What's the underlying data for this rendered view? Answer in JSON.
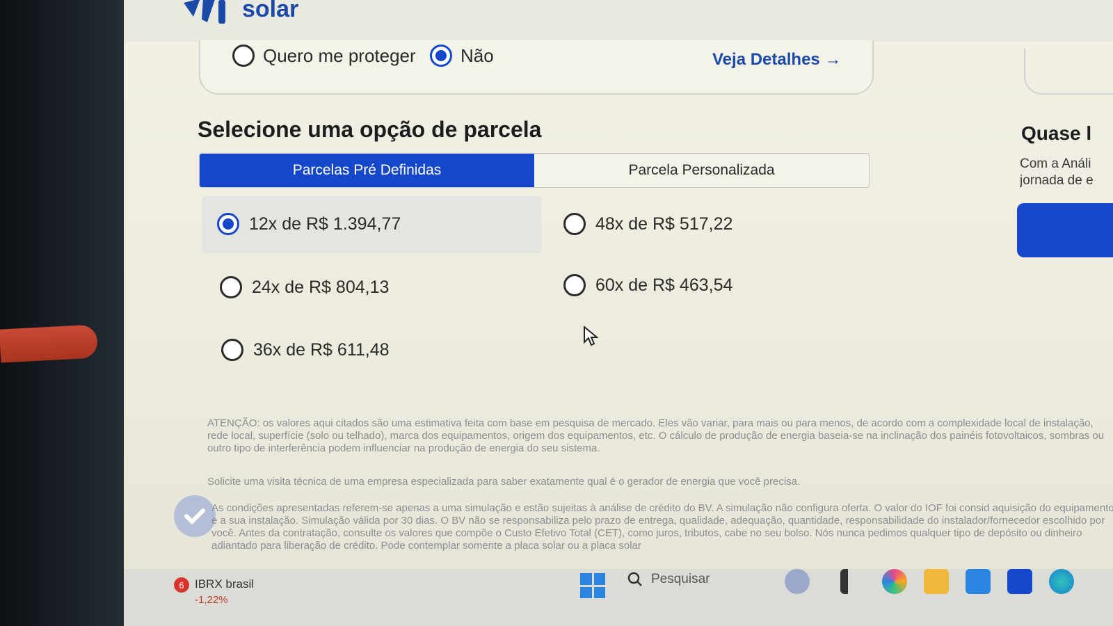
{
  "app": {
    "logo_text": "solar",
    "brand_color": "#1447c9"
  },
  "insurance": {
    "options": [
      {
        "label": "Quero me proteger",
        "selected": false
      },
      {
        "label": "Não",
        "selected": true
      }
    ],
    "details_link": "Veja Detalhes →"
  },
  "installments": {
    "title": "Selecione uma opção de parcela",
    "tabs": [
      {
        "label": "Parcelas Pré Definidas",
        "active": true
      },
      {
        "label": "Parcela Personalizada",
        "active": false
      }
    ],
    "options": [
      {
        "label": "12x de R$ 1.394,77",
        "selected": true
      },
      {
        "label": "24x de R$ 804,13",
        "selected": false
      },
      {
        "label": "36x de R$ 611,48",
        "selected": false
      },
      {
        "label": "48x de R$ 517,22",
        "selected": false
      },
      {
        "label": "60x de R$ 463,54",
        "selected": false
      }
    ]
  },
  "side_panel": {
    "title": "Quase l",
    "text_line1": "Com a Análi",
    "text_line2": "jornada de e"
  },
  "disclaimers": {
    "attention": "ATENÇÃO: os valores aqui citados são uma estimativa feita com base em pesquisa de mercado. Eles vão variar, para mais ou para menos, de acordo com a complexidade local de instalação, rede local, superfície (solo ou telhado), marca dos equipamentos, origem dos equipamentos, etc. O cálculo de produção de energia baseia-se na inclinação dos painéis fotovoltaicos, sombras ou outro tipo de interferência podem influenciar na produção de energia do seu sistema.",
    "visit": "Solicite uma visita técnica de uma empresa especializada para saber exatamente qual é o gerador de energia que você precisa.",
    "conditions": "As condições apresentadas referem-se apenas a uma simulação e estão sujeitas à análise de crédito do BV. A simulação não configura oferta. O valor do IOF foi consid aquisição do equipamento e a sua instalação. Simulação válida por 30 dias. O BV não se responsabiliza pelo prazo de entrega, qualidade, adequação, quantidade, responsabilidade do instalador/fornecedor escolhido por você. Antes da contratação, consulte os valores que compõe o Custo Efetivo Total (CET), como juros, tributos, cabe no seu bolso. Nós nunca pedimos qualquer tipo de depósito ou dinheiro adiantado para liberação de crédito. Pode contemplar somente a placa solar ou a placa solar"
  },
  "taskbar": {
    "stock_name": "IBRX brasil",
    "stock_change": "-1,22%",
    "notification_count": "6",
    "search_label": "Pesquisar"
  }
}
